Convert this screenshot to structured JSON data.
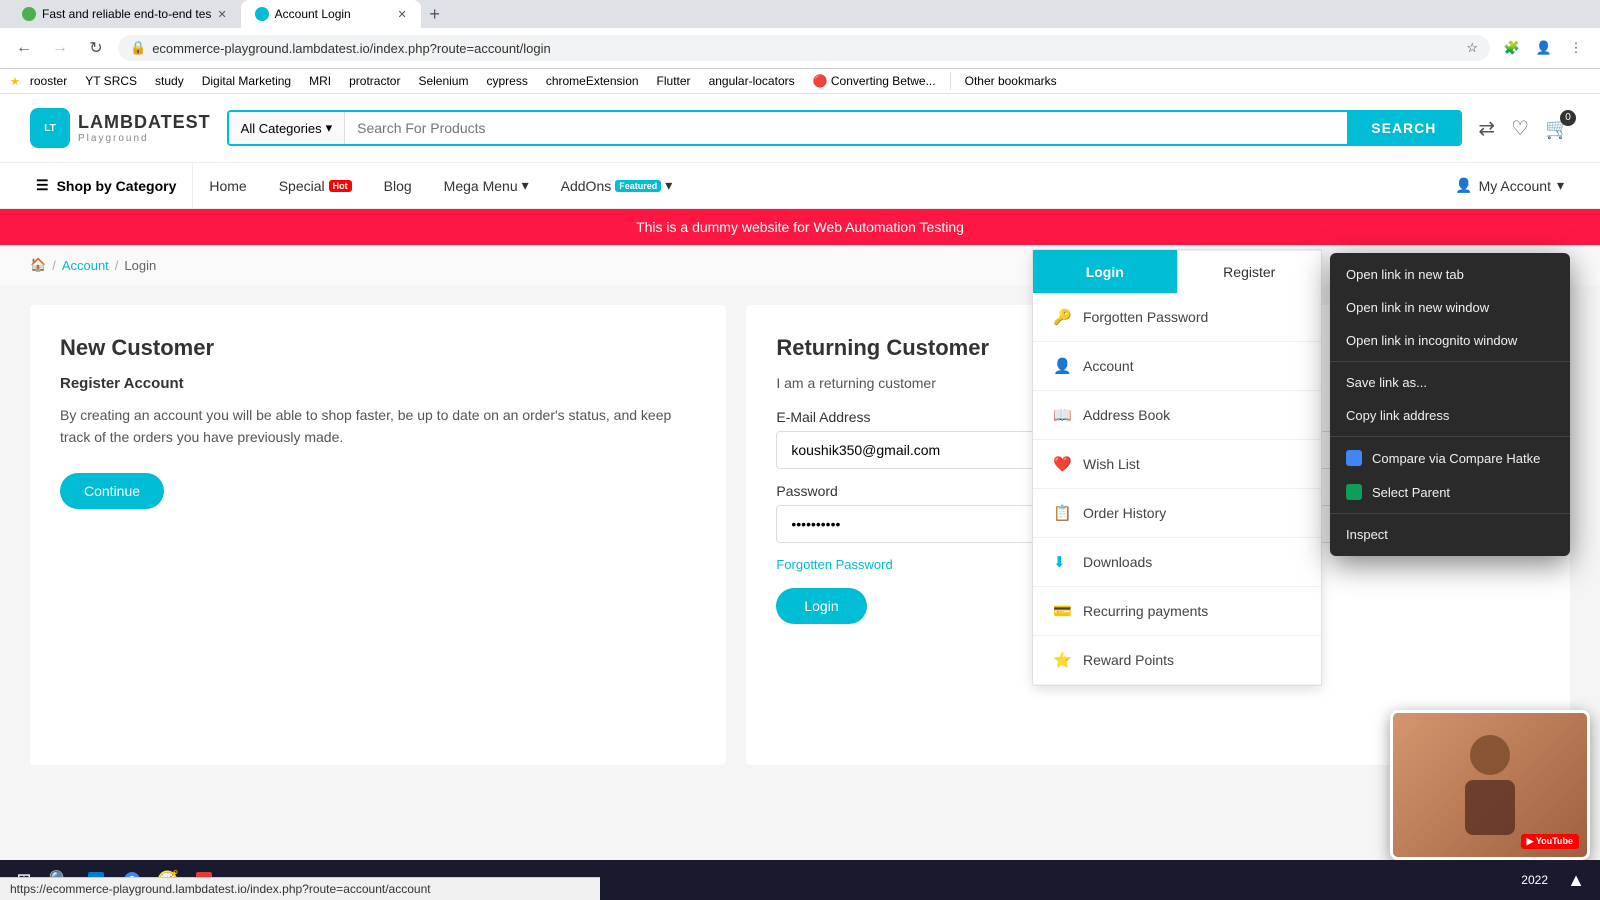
{
  "browser": {
    "tabs": [
      {
        "id": "tab1",
        "label": "Fast and reliable end-to-end tes",
        "favicon_color": "#4caf50",
        "active": false
      },
      {
        "id": "tab2",
        "label": "Account Login",
        "favicon_color": "#00bcd4",
        "active": true
      }
    ],
    "address": "ecommerce-playground.lambdatest.io/index.php?route=account/login",
    "bookmarks": [
      "rooster",
      "YT SRCS",
      "study",
      "Digital Marketing",
      "MRI",
      "protractor",
      "Selenium",
      "cypress",
      "chromeExtension",
      "Flutter",
      "angular-locators",
      "Converting Betwe...",
      "Other bookmarks"
    ]
  },
  "site": {
    "logo_text": "LAMBDATEST",
    "logo_sub": "Playground",
    "search_placeholder": "Search For Products",
    "search_category": "All Categories",
    "search_btn": "SEARCH",
    "announcement": "This is a dummy website for Web Automation Testing",
    "nav": {
      "shop_by_category": "Shop by Category",
      "home": "Home",
      "special": "Special",
      "special_badge": "Hot",
      "blog": "Blog",
      "mega_menu": "Mega Menu",
      "addons": "AddOns",
      "addons_badge": "Featured",
      "my_account": "My Account"
    },
    "breadcrumb": {
      "home": "🏠",
      "account": "Account",
      "login": "Login"
    },
    "new_customer": {
      "title": "New Customer",
      "subtitle": "Register Account",
      "description": "By creating an account you will be able to shop faster, be up to date on an order's status, and keep track of the orders you have previously made.",
      "continue_btn": "Continue"
    },
    "returning_customer": {
      "title": "Returning Customer",
      "subtitle": "I am a returning customer",
      "email_label": "E-Mail Address",
      "email_value": "koushik350@gmail.com",
      "password_label": "Password",
      "password_value": "••••••••••",
      "forgotten_link": "Forgotten Password",
      "login_btn": "Login"
    },
    "account_dropdown": {
      "forgotten_password": "Forgotten Password",
      "my_account": "Account",
      "address_book": "Address Book",
      "wish_list": "Wish List",
      "order_history": "Order History",
      "downloads": "Downloads",
      "recurring_payments": "Recurring payments",
      "reward_points": "Reward Points",
      "login_btn": "Login",
      "register_btn": "Register"
    },
    "context_menu": {
      "open_new_tab": "Open link in new tab",
      "open_new_window": "Open link in new window",
      "open_incognito": "Open link in incognito window",
      "save_link_as": "Save link as...",
      "copy_link": "Copy link address",
      "compare_hatke": "Compare via Compare Hatke",
      "select_parent": "Select Parent",
      "inspect": "Inspect"
    }
  },
  "status_bar_url": "https://ecommerce-playground.lambdatest.io/index.php?route=account/account",
  "colors": {
    "primary": "#00bcd4",
    "danger": "#ff1744"
  }
}
